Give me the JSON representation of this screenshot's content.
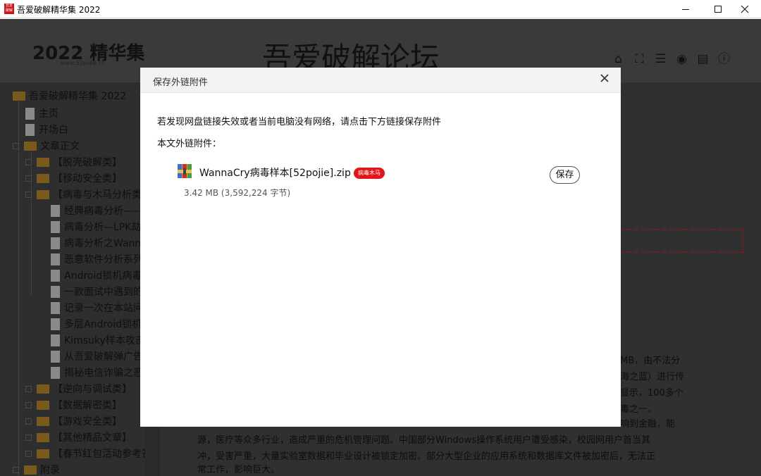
{
  "window": {
    "title": "吾爱破解精华集 2022",
    "icon_text": "吾爱破解",
    "minimize_icon": "minimize-icon",
    "maximize_icon": "maximize-icon",
    "close_icon": "close-icon"
  },
  "header": {
    "logo_year": "2022 精华集",
    "logo_url": "www.52pojie.cn",
    "forum_title": "吾爱破解论坛",
    "icons": [
      "home-icon",
      "fullscreen-icon",
      "list-icon",
      "eye-icon",
      "print-icon",
      "info-icon"
    ]
  },
  "sidebar": {
    "root": "吾爱破解精华集 2022",
    "items": [
      {
        "label": "主页",
        "type": "doc"
      },
      {
        "label": "开场白",
        "type": "doc"
      },
      {
        "label": "文章正文",
        "type": "folder"
      },
      {
        "label": "【脱壳破解类】",
        "type": "folder"
      },
      {
        "label": "【移动安全类】",
        "type": "folder"
      },
      {
        "label": "【病毒与木马分析类",
        "type": "folder"
      },
      {
        "label": "经典病毒分析——",
        "type": "doc"
      },
      {
        "label": "病毒分析—LPK劫",
        "type": "doc"
      },
      {
        "label": "病毒分析之Wann",
        "type": "doc"
      },
      {
        "label": "恶意软件分析系列",
        "type": "doc"
      },
      {
        "label": "Android锁机病毒",
        "type": "doc"
      },
      {
        "label": "一款面试中遇到的",
        "type": "doc"
      },
      {
        "label": "记录一次在本站问",
        "type": "doc"
      },
      {
        "label": "多层Android锁机",
        "type": "doc"
      },
      {
        "label": "Kimsuky样本攻击",
        "type": "doc"
      },
      {
        "label": "从吾爱破解弹广告",
        "type": "doc"
      },
      {
        "label": "揭秘电信诈骗之恶",
        "type": "doc"
      },
      {
        "label": "【逆向与调试类】",
        "type": "folder"
      },
      {
        "label": "【数据解密类】",
        "type": "folder"
      },
      {
        "label": "【游戏安全类】",
        "type": "folder"
      },
      {
        "label": "【其他精品文章】",
        "type": "folder"
      },
      {
        "label": "【春节红包活动参考答",
        "type": "folder"
      },
      {
        "label": "附录",
        "type": "folder"
      }
    ]
  },
  "content": {
    "lines": [
      "MB，由不法分",
      "海之蓝）进行传",
      "显示，100多个",
      "毒之一。",
      "响到金融，能",
      "源，医疗等众多行业，造成严重的危机管理问题。中国部分Windows操作系统用户遭受感染，校园网用户首当其",
      "冲，受害严重，大量实验室数据和毕业设计被锁定加密。部分大型企业的应用系统和数据库文件被加密后，无法正",
      "常工作，影响巨大。"
    ]
  },
  "dialog": {
    "title": "保存外链附件",
    "message": "若发现网盘链接失效或者当前电脑没有网络，请点击下方链接保存附件",
    "label": "本文外链附件：",
    "file_name": "WannaCry病毒样本[52pojie].zip",
    "tag": "病毒木马",
    "file_size": "3.42 MB (3,592,224 字节)",
    "save_label": "保存",
    "file_icon": "zip-archive-icon",
    "close_icon": "close-icon",
    "tag_color": "#e2151b"
  }
}
